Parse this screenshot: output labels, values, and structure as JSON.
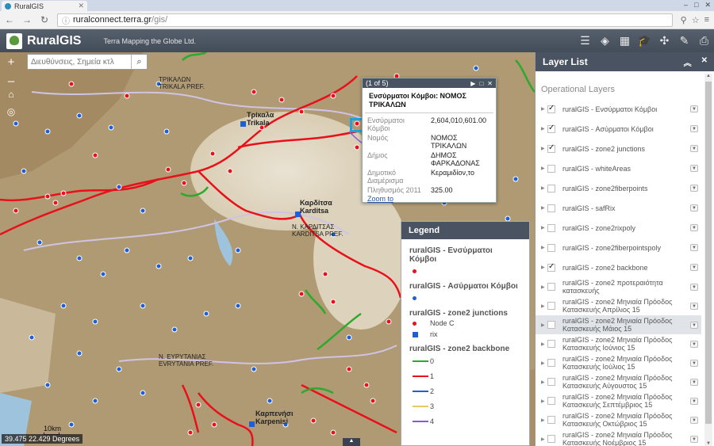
{
  "browser": {
    "tab_title": "RuralGIS",
    "url_proto": "ⓘ",
    "url_host": "ruralconnect.terra.gr",
    "url_path": "/gis/"
  },
  "app": {
    "title": "RuralGIS",
    "subtitle": "Terra Mapping the Globe Ltd.",
    "tools": [
      "list-icon",
      "layers-icon",
      "basemap-icon",
      "education-icon",
      "share-icon",
      "measure-icon",
      "print-icon"
    ]
  },
  "map": {
    "search_placeholder": "Διευθύνσεις, Σημεία κτλ",
    "coordinates": "39.475 22.429 Degrees",
    "scale_label": "10km",
    "places": [
      {
        "name": "Τρίκαλα",
        "sub": "Trikala"
      },
      {
        "name": "Καρδίτσα",
        "sub": "Karditsa"
      },
      {
        "name": "Καρπενήσι",
        "sub": "Karpenisi"
      },
      {
        "name": "Ν. ΚΑΡΔΙΤΣΑΣ",
        "sub": "KARDITSA PREF."
      },
      {
        "name": "ΤΡΙΚΑΛΩΝ",
        "sub": "TRIKALA PREF."
      },
      {
        "name": "Ν. ΕΥΡΥΤΑΝΙΑΣ",
        "sub": "EVRYTANIA PREF."
      }
    ]
  },
  "popup": {
    "counter": "(1 of 5)",
    "title": "Ενσύρματοι Κόμβοι: ΝΟΜΟΣ ΤΡΙΚΑΛΩΝ",
    "rows": [
      {
        "k": "Ενσύρματοι Κόμβοι",
        "v": "2,604,010,601.00"
      },
      {
        "k": "Νομός",
        "v": "ΝΟΜΟΣ ΤΡΙΚΑΛΩΝ"
      },
      {
        "k": "Δήμος",
        "v": "ΔΗΜΟΣ ΦΑΡΚΑΔΟΝΑΣ"
      },
      {
        "k": "Δημοτικό Διαμέρισμα",
        "v": "Κεραμιδίον,το"
      },
      {
        "k": "Πληθυσμός 2011",
        "v": "325.00"
      }
    ],
    "zoom_label": "Zoom to"
  },
  "legend": {
    "title": "Legend",
    "groups": [
      {
        "layer": "ruralGIS - Ενσύρματοι Κόμβοι",
        "items": [
          {
            "label": "",
            "sym": "dot",
            "color": "#e8101a"
          }
        ]
      },
      {
        "layer": "ruralGIS - Ασύρματοι Κόμβοι",
        "items": [
          {
            "label": "",
            "sym": "dot",
            "color": "#1f5fd6"
          }
        ]
      },
      {
        "layer": "ruralGIS - zone2 junctions",
        "items": [
          {
            "label": "Node C",
            "sym": "dot",
            "color": "#e8101a"
          },
          {
            "label": "rix",
            "sym": "sq",
            "color": "#1f5fd6"
          }
        ]
      },
      {
        "layer": "ruralGIS - zone2 backbone",
        "items": [
          {
            "label": "0",
            "sym": "ln",
            "color": "#2da92d"
          },
          {
            "label": "1",
            "sym": "ln",
            "color": "#e8101a"
          },
          {
            "label": "2",
            "sym": "ln",
            "color": "#1f5fd6"
          },
          {
            "label": "3",
            "sym": "ln",
            "color": "#e8c86a"
          },
          {
            "label": "4",
            "sym": "ln",
            "color": "#8a5ad6"
          }
        ]
      }
    ]
  },
  "layer_list": {
    "title": "Layer List",
    "section": "Operational Layers",
    "items": [
      {
        "label": "ruralGIS - Ενσύρματοι Κόμβοι",
        "checked": true
      },
      {
        "label": "ruralGIS - Ασύρματοι Κόμβοι",
        "checked": true
      },
      {
        "label": "ruralGIS - zone2 junctions",
        "checked": true
      },
      {
        "label": "ruralGIS - whiteAreas",
        "checked": false
      },
      {
        "label": "ruralGIS - zone2fiberpoints",
        "checked": false
      },
      {
        "label": "ruralGIS - safRix",
        "checked": false
      },
      {
        "label": "ruralGIS - zone2rixpoly",
        "checked": false
      },
      {
        "label": "ruralGIS - zone2fiberpointspoly",
        "checked": false
      },
      {
        "label": "ruralGIS - zone2 backbone",
        "checked": true
      },
      {
        "label": "ruralGIS - zone2 προτεραιότητα κατασκευής",
        "checked": false
      },
      {
        "label": "ruralGIS - zone2 Μηνιαία Πρόοδος Κατασκευής Απρίλιος 15",
        "checked": false
      },
      {
        "label": "ruralGIS - zone2 Μηνιαία Πρόοδος Κατασκευής Μάιος 15",
        "checked": false
      },
      {
        "label": "ruralGIS - zone2 Μηνιαία Πρόοδος Κατασκευής Ιούνιος 15",
        "checked": false
      },
      {
        "label": "ruralGIS - zone2 Μηνιαία Πρόοδος Κατασκευής Ιούλιος 15",
        "checked": false
      },
      {
        "label": "ruralGIS - zone2 Μηνιαία Πρόοδος Κατασκευής Αύγουστος 15",
        "checked": false
      },
      {
        "label": "ruralGIS - zone2 Μηνιαία Πρόοδος Κατασκευής Σεπτέμβριος 15",
        "checked": false
      },
      {
        "label": "ruralGIS - zone2 Μηνιαία Πρόοδος Κατασκευής Οκτώβριος 15",
        "checked": false
      },
      {
        "label": "ruralGIS - zone2 Μηνιαία Πρόοδος Κατασκευής Νοέμβριος 15",
        "checked": false
      }
    ]
  }
}
